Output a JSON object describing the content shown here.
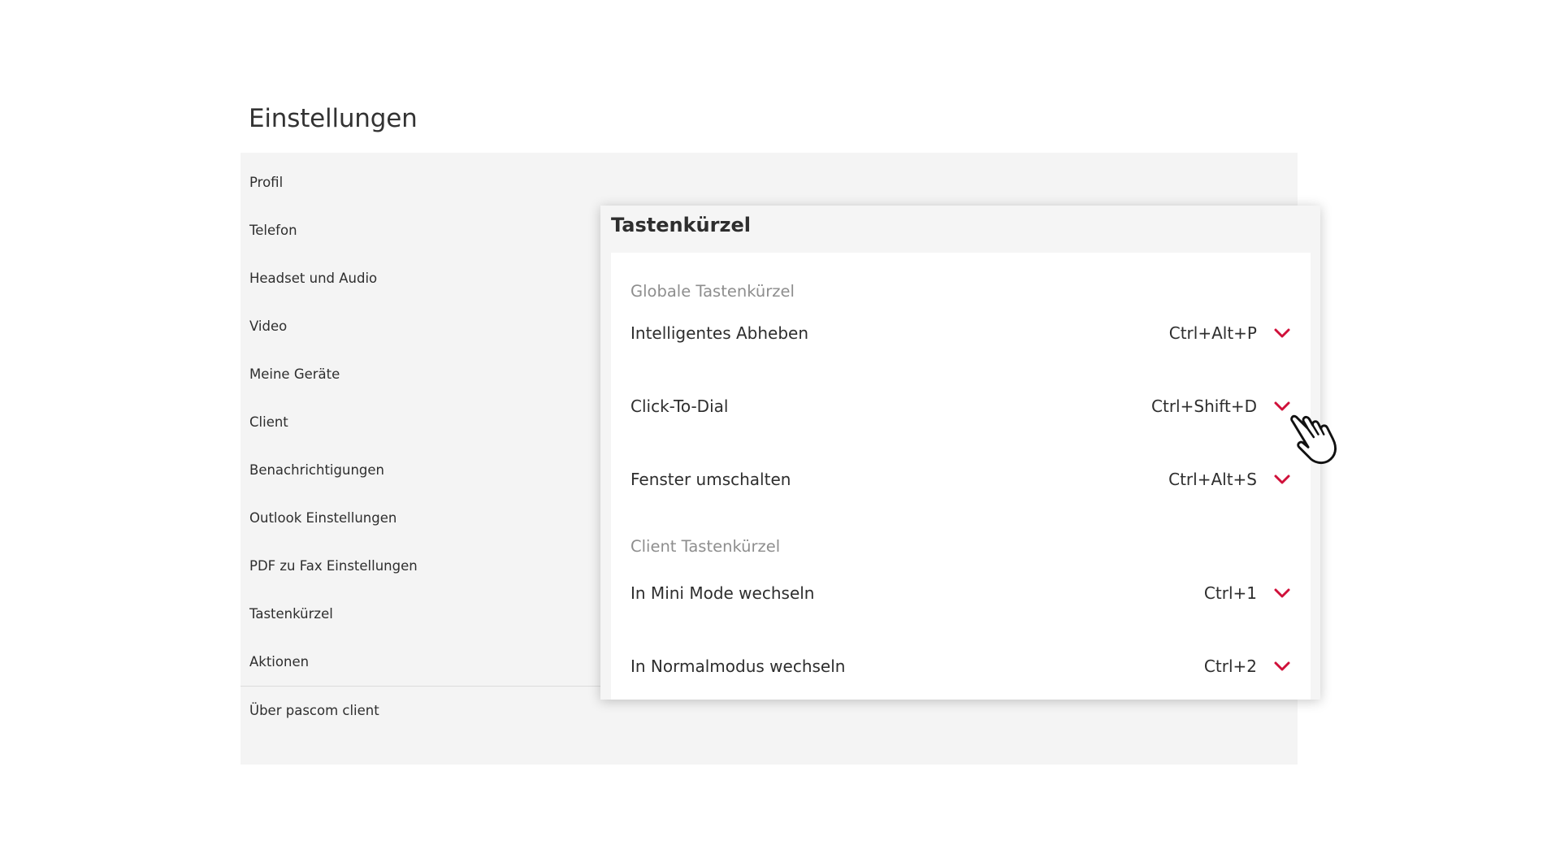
{
  "page": {
    "title": "Einstellungen"
  },
  "sidebar": {
    "items": [
      {
        "label": "Profil"
      },
      {
        "label": "Telefon"
      },
      {
        "label": "Headset und Audio"
      },
      {
        "label": "Video"
      },
      {
        "label": "Meine Geräte"
      },
      {
        "label": "Client"
      },
      {
        "label": "Benachrichtigungen"
      },
      {
        "label": "Outlook Einstellungen"
      },
      {
        "label": "PDF zu Fax Einstellungen"
      },
      {
        "label": "Tastenkürzel"
      },
      {
        "label": "Aktionen"
      }
    ],
    "footer_item": {
      "label": "Über pascom client"
    }
  },
  "dialog": {
    "title": "Tastenkürzel",
    "sections": [
      {
        "heading": "Globale Tastenkürzel",
        "rows": [
          {
            "label": "Intelligentes Abheben",
            "shortcut": "Ctrl+Alt+P"
          },
          {
            "label": "Click-To-Dial",
            "shortcut": "Ctrl+Shift+D"
          },
          {
            "label": "Fenster umschalten",
            "shortcut": "Ctrl+Alt+S"
          }
        ]
      },
      {
        "heading": "Client Tastenkürzel",
        "rows": [
          {
            "label": "In Mini Mode wechseln",
            "shortcut": "Ctrl+1"
          },
          {
            "label": "In Normalmodus wechseln",
            "shortcut": "Ctrl+2"
          }
        ]
      }
    ]
  },
  "colors": {
    "accent": "#d0103a",
    "panel_background": "#f4f4f4",
    "section_heading": "#8e8e8e"
  },
  "icons": {
    "dropdown": "chevron-down-icon",
    "cursor": "hand-pointer-icon"
  }
}
